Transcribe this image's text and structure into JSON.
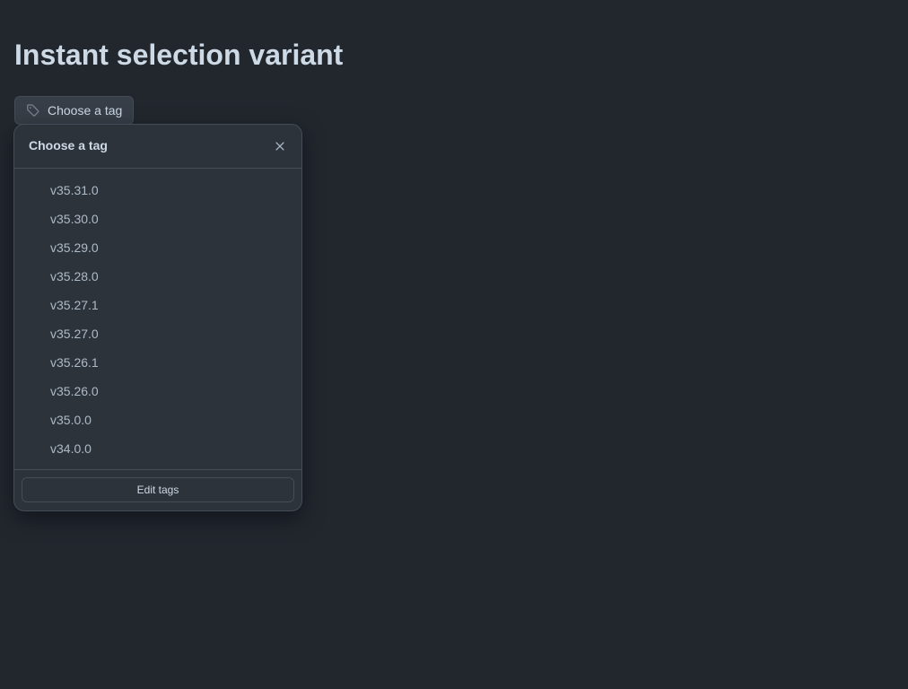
{
  "page": {
    "title": "Instant selection variant"
  },
  "trigger": {
    "icon": "tag-icon",
    "label": "Choose a tag"
  },
  "panel": {
    "title": "Choose a tag",
    "close_icon": "close-icon",
    "items": [
      {
        "label": "v35.31.0"
      },
      {
        "label": "v35.30.0"
      },
      {
        "label": "v35.29.0"
      },
      {
        "label": "v35.28.0"
      },
      {
        "label": "v35.27.1"
      },
      {
        "label": "v35.27.0"
      },
      {
        "label": "v35.26.1"
      },
      {
        "label": "v35.26.0"
      },
      {
        "label": "v35.0.0"
      },
      {
        "label": "v34.0.0"
      }
    ],
    "footer_button_label": "Edit tags"
  },
  "colors": {
    "background": "#22272e",
    "panel": "#2d333b",
    "border": "#444c56",
    "text": "#cdd9e5",
    "muted_text": "#adbac7"
  }
}
